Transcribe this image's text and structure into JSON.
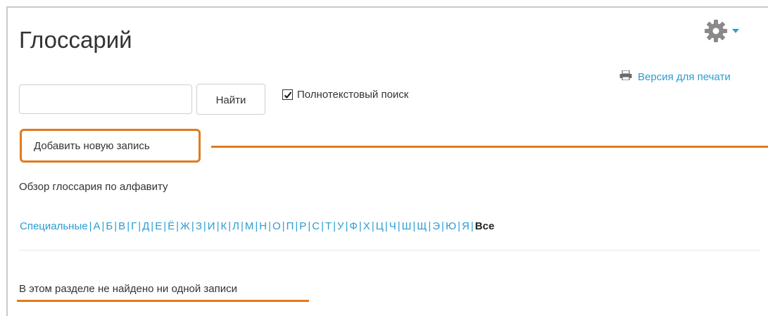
{
  "page": {
    "title": "Глоссарий"
  },
  "toolbar": {
    "print_link_label": "Версия для печати"
  },
  "search": {
    "value": "",
    "placeholder": "",
    "button_label": "Найти",
    "fulltext_label": "Полнотекстовый поиск",
    "fulltext_checked": true
  },
  "actions": {
    "add_entry_label": "Добавить новую запись"
  },
  "browse": {
    "label": "Обзор глоссария по алфавиту",
    "special_label": "Специальные",
    "letters": [
      "А",
      "Б",
      "В",
      "Г",
      "Д",
      "Е",
      "Ё",
      "Ж",
      "З",
      "И",
      "К",
      "Л",
      "М",
      "Н",
      "О",
      "П",
      "Р",
      "С",
      "Т",
      "У",
      "Ф",
      "Х",
      "Ц",
      "Ч",
      "Ш",
      "Щ",
      "Э",
      "Ю",
      "Я"
    ],
    "all_label": "Все"
  },
  "results": {
    "empty_message": "В этом разделе не найдено ни одной записи"
  },
  "colors": {
    "link": "#2b9dd1",
    "highlight": "#e07b1f",
    "text": "#333333"
  },
  "icons": {
    "settings": "gear-icon",
    "dropdown": "caret-down-icon",
    "print": "printer-icon",
    "checkbox": "check-icon"
  }
}
